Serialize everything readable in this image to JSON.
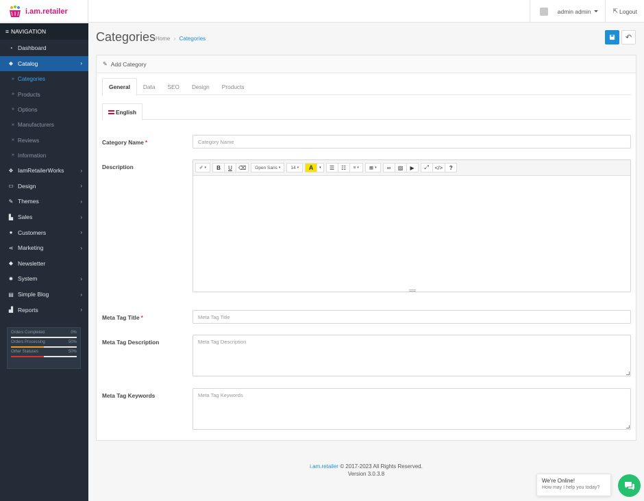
{
  "brand": {
    "name": "i.am.retailer",
    "accent": "#d6197a"
  },
  "header": {
    "user_label": "admin admin",
    "logout_label": "Logout",
    "icons": {
      "user": "user-avatar-icon",
      "logout": "logout-icon"
    }
  },
  "sidebar": {
    "heading": "NAVIGATION",
    "items": [
      {
        "label": "Dashboard",
        "icon": "dashboard-icon",
        "has_children": false
      },
      {
        "label": "Catalog",
        "icon": "tag-icon",
        "has_children": true,
        "active": true
      },
      {
        "label": "IamRetailerWorks",
        "icon": "cubes-icon",
        "has_children": true
      },
      {
        "label": "Design",
        "icon": "monitor-icon",
        "has_children": true
      },
      {
        "label": "Themes",
        "icon": "brush-icon",
        "has_children": true
      },
      {
        "label": "Sales",
        "icon": "cart-icon",
        "has_children": true
      },
      {
        "label": "Customers",
        "icon": "user-icon",
        "has_children": true
      },
      {
        "label": "Marketing",
        "icon": "share-icon",
        "has_children": true
      },
      {
        "label": "Newsletter",
        "icon": "tags-icon",
        "has_children": false
      },
      {
        "label": "System",
        "icon": "cog-icon",
        "has_children": true
      },
      {
        "label": "Simple Blog",
        "icon": "document-icon",
        "has_children": true
      },
      {
        "label": "Reports",
        "icon": "bar-chart-icon",
        "has_children": true
      }
    ],
    "catalog_sub": [
      {
        "label": "Categories",
        "active": true
      },
      {
        "label": "Products"
      },
      {
        "label": "Options"
      },
      {
        "label": "Manufacturers"
      },
      {
        "label": "Reviews"
      },
      {
        "label": "Information"
      }
    ],
    "stats": [
      {
        "label": "Orders Completed",
        "value": "0%",
        "percent": 0,
        "color": "#3fa5e8"
      },
      {
        "label": "Orders Processing",
        "value": "50%",
        "percent": 50,
        "color": "#f0a020"
      },
      {
        "label": "Other Statuses",
        "value": "50%",
        "percent": 50,
        "color": "#d9342b"
      }
    ]
  },
  "page": {
    "title": "Categories",
    "breadcrumb": [
      "Home",
      "Categories"
    ]
  },
  "panel": {
    "heading": "Add Category",
    "tabs": [
      "General",
      "Data",
      "SEO",
      "Design",
      "Products"
    ],
    "active_tab": "General",
    "language": "English",
    "fields": {
      "category_name": {
        "label": "Category Name",
        "placeholder": "Category Name",
        "required": true
      },
      "description": {
        "label": "Description"
      },
      "meta_title": {
        "label": "Meta Tag Title",
        "placeholder": "Meta Tag Title",
        "required": true
      },
      "meta_description": {
        "label": "Meta Tag Description",
        "placeholder": "Meta Tag Description"
      },
      "meta_keywords": {
        "label": "Meta Tag Keywords",
        "placeholder": "Meta Tag Keywords"
      }
    },
    "editor": {
      "font_family": "Open Sans",
      "font_size": "14"
    }
  },
  "footer": {
    "brand": "i.am.retailer",
    "copyright": "© 2017-2023 All Rights Reserved.",
    "version": "Version 3.0.3.8"
  },
  "chat": {
    "title": "We're Online!",
    "subtitle": "How may I help you today?",
    "color": "#25c16f"
  },
  "colors": {
    "sidebar_bg": "#232c37",
    "primary": "#1e8fd5",
    "required": "#d9342b"
  }
}
